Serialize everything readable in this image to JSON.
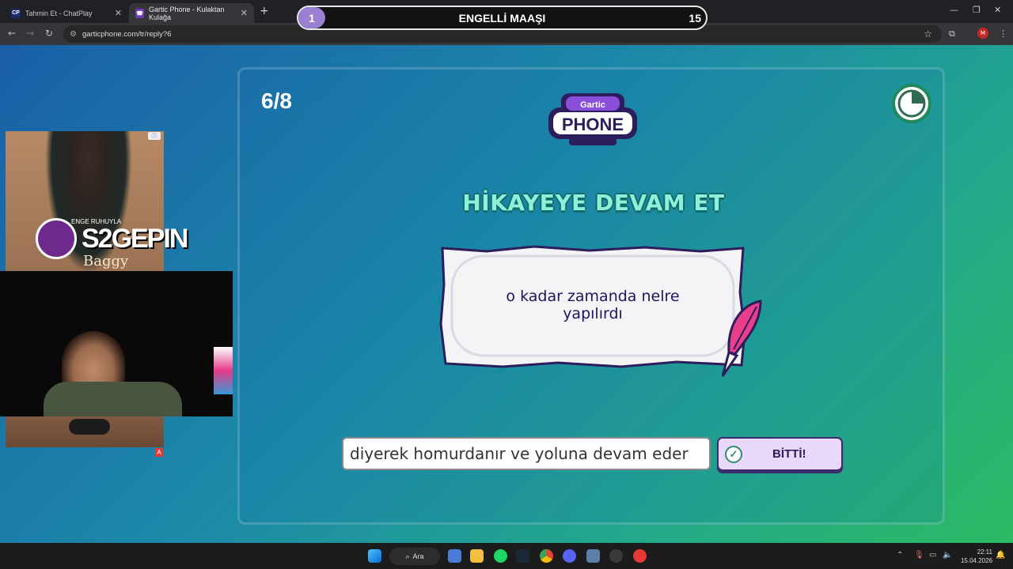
{
  "browser": {
    "tabs": [
      {
        "title": "Tahmin Et - ChatPlay",
        "favicon": "CP"
      },
      {
        "title": "Gartic Phone - Kulaktan Kulağa",
        "favicon": "☎"
      }
    ],
    "url": "garticphone.com/tr/reply?6",
    "profile_initial": "M"
  },
  "overlay": {
    "left_number": "1",
    "title": "ENGELLİ MAAŞI",
    "right_number": "15"
  },
  "game": {
    "counter": "6/8",
    "logo_top": "Gartic",
    "logo_main": "PHONE",
    "heading": "HİKAYEYE DEVAM ET",
    "prompt": "o kadar zamanda nelre yapılırdı",
    "answer_value": "diyerek homurdanır ve yoluna devam eder",
    "done_label": "BİTTİ!"
  },
  "stream": {
    "brand": "S2GEPIN",
    "brand_small": "ENGE RUHUYLA",
    "brand_sub": "Baggy",
    "ad_badge": "A"
  },
  "taskbar": {
    "search_label": "Ara",
    "time": "22:11",
    "date": "15.04.2026"
  },
  "colors": {
    "heading": "#8df0d8",
    "done_bg": "#e8d8fb",
    "prompt_text": "#1f1460"
  }
}
